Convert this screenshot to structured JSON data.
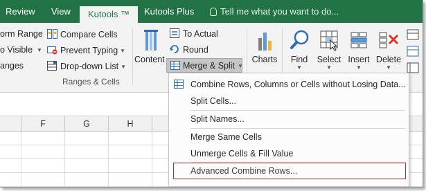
{
  "tabs": [
    {
      "label": "Review",
      "active": false
    },
    {
      "label": "View",
      "active": false
    },
    {
      "label": "Kutools ™",
      "active": true
    },
    {
      "label": "Kutools Plus",
      "active": false
    }
  ],
  "tell_me": "Tell me what you want to do...",
  "ribbon": {
    "left_items": [
      {
        "label": "orm Range"
      },
      {
        "label": "o Visible"
      },
      {
        "label": "anges"
      }
    ],
    "middle_items": [
      {
        "label": "Compare Cells"
      },
      {
        "label": "Prevent Typing"
      },
      {
        "label": "Drop-down List"
      }
    ],
    "group_label": "Ranges & Cells",
    "content_label": "Content",
    "to_actual": "To Actual",
    "round": "Round",
    "merge_split": "Merge & Split",
    "charts": "Charts",
    "find": "Find",
    "select": "Select",
    "insert": "Insert",
    "delete": "Delete"
  },
  "columns": [
    "F",
    "G",
    "H"
  ],
  "menu": {
    "items": [
      {
        "label": "Combine Rows, Columns or Cells without Losing Data..."
      },
      {
        "label": "Split Cells..."
      },
      {
        "label": "Split Names..."
      },
      {
        "label": "Merge Same Cells"
      },
      {
        "label": "Unmerge Cells & Fill Value"
      },
      {
        "label": "Advanced Combine Rows..."
      }
    ]
  },
  "colors": {
    "tab_bar": "#217346",
    "highlight_box": "#b02a2a"
  }
}
